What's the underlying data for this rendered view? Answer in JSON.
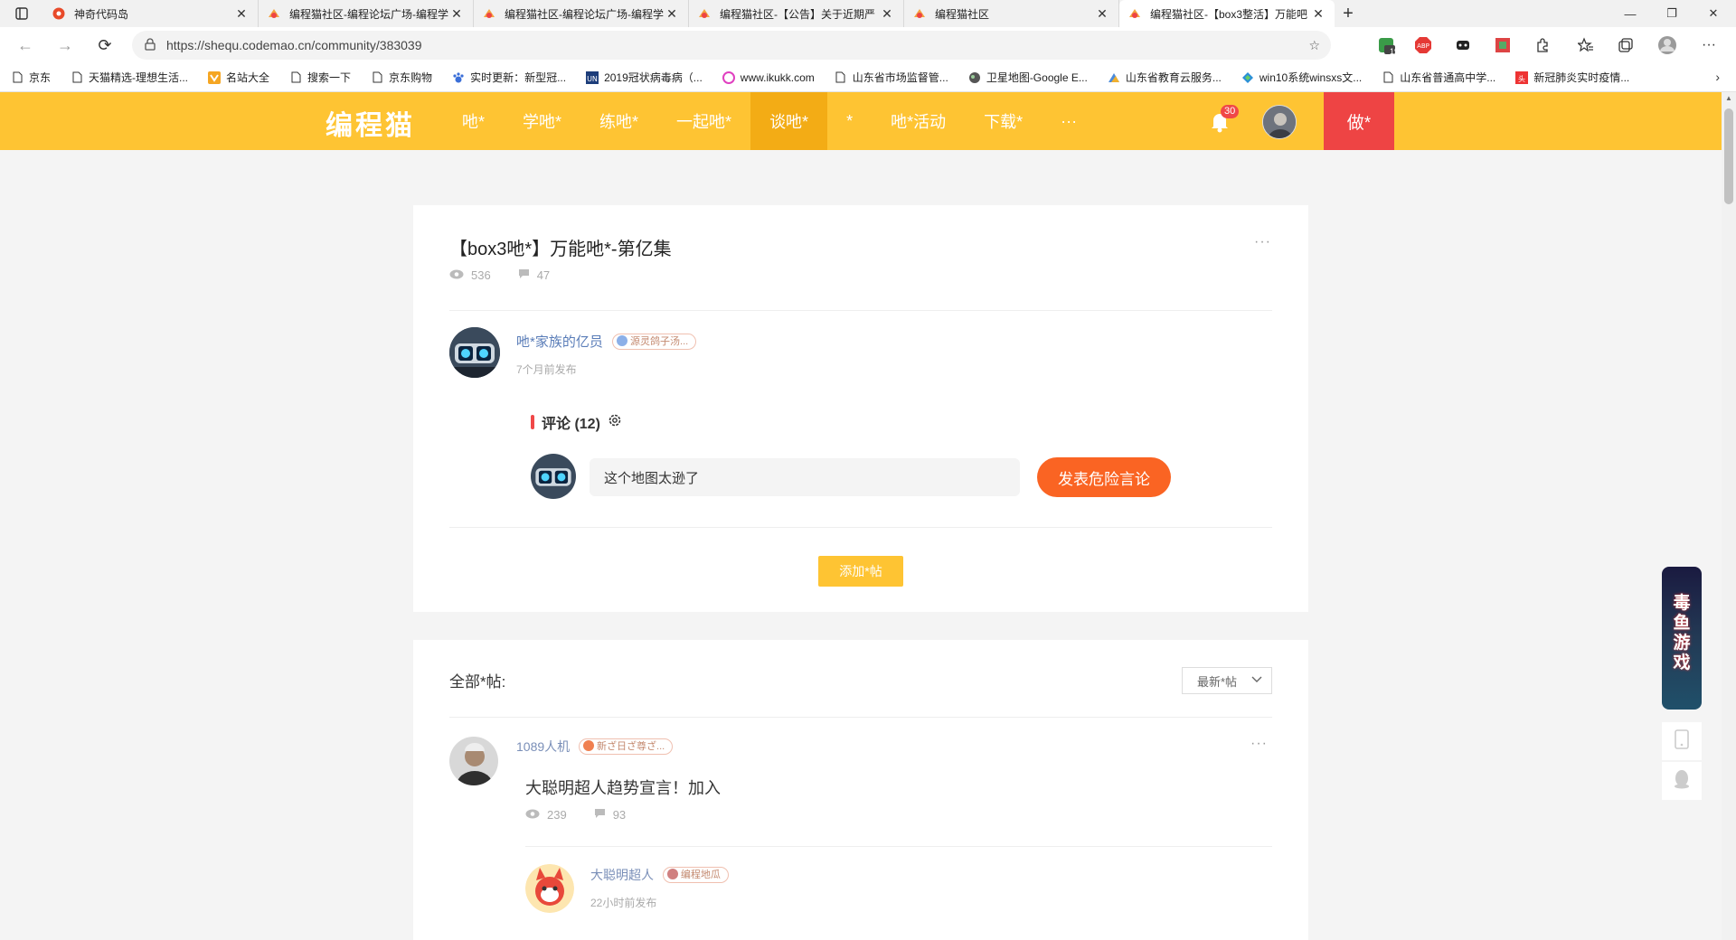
{
  "browser": {
    "tabs": [
      {
        "title": "神奇代码岛",
        "active": false
      },
      {
        "title": "编程猫社区-编程论坛广场-编程学",
        "active": false
      },
      {
        "title": "编程猫社区-编程论坛广场-编程学",
        "active": false
      },
      {
        "title": "编程猫社区-【公告】关于近期严",
        "active": false
      },
      {
        "title": "编程猫社区",
        "active": false
      },
      {
        "title": "编程猫社区-【box3整活】万能吧",
        "active": true
      }
    ],
    "url": "https://shequ.codemao.cn/community/383039",
    "ext_badge": "19",
    "bookmarks": [
      "京东",
      "天猫精选-理想生活...",
      "名站大全",
      "搜索一下",
      "京东购物",
      "实时更新：新型冠...",
      "2019冠状病毒病（...",
      "www.ikukk.com",
      "山东省市场监督管...",
      "卫星地图-Google E...",
      "山东省教育云服务...",
      "win10系统winsxs文...",
      "山东省普通高中学...",
      "新冠肺炎实时疫情..."
    ]
  },
  "site": {
    "logo": "编程猫",
    "nav": [
      "吔*",
      "学吔*",
      "练吔*",
      "一起吔*",
      "谈吔*",
      "*",
      "吔*活动",
      "下载*",
      "···"
    ],
    "notif_count": "30",
    "make_label": "做*"
  },
  "post": {
    "title": "【box3吔*】万能吔*-第亿集",
    "views": "536",
    "comments": "47",
    "author": "吔*家族的亿员",
    "author_badge": "源灵鸽子汤...",
    "time": "7个月前发布"
  },
  "comment": {
    "header": "评论 (12)",
    "input_value": "这个地图太逊了",
    "submit_label": "发表危险言论",
    "add_label": "添加*帖"
  },
  "replies_section": {
    "title": "全部*帖:",
    "sort_label": "最新*帖",
    "reply1": {
      "author": "1089人机",
      "badge": "新ざ日ざ尊ざ...",
      "text": "大聪明超人趋势宣言！加入",
      "views": "239",
      "comments": "93"
    },
    "reply2": {
      "author": "大聪明超人",
      "badge": "编程地瓜",
      "time": "22小时前发布"
    }
  },
  "floating": {
    "banner_text": "毒鱼游戏"
  },
  "colors": {
    "header_yellow": "#fec433",
    "nav_active": "#f3ac15",
    "make_red": "#ee4444",
    "submit_orange": "#fa6423",
    "link_blue": "#5a7db8"
  }
}
